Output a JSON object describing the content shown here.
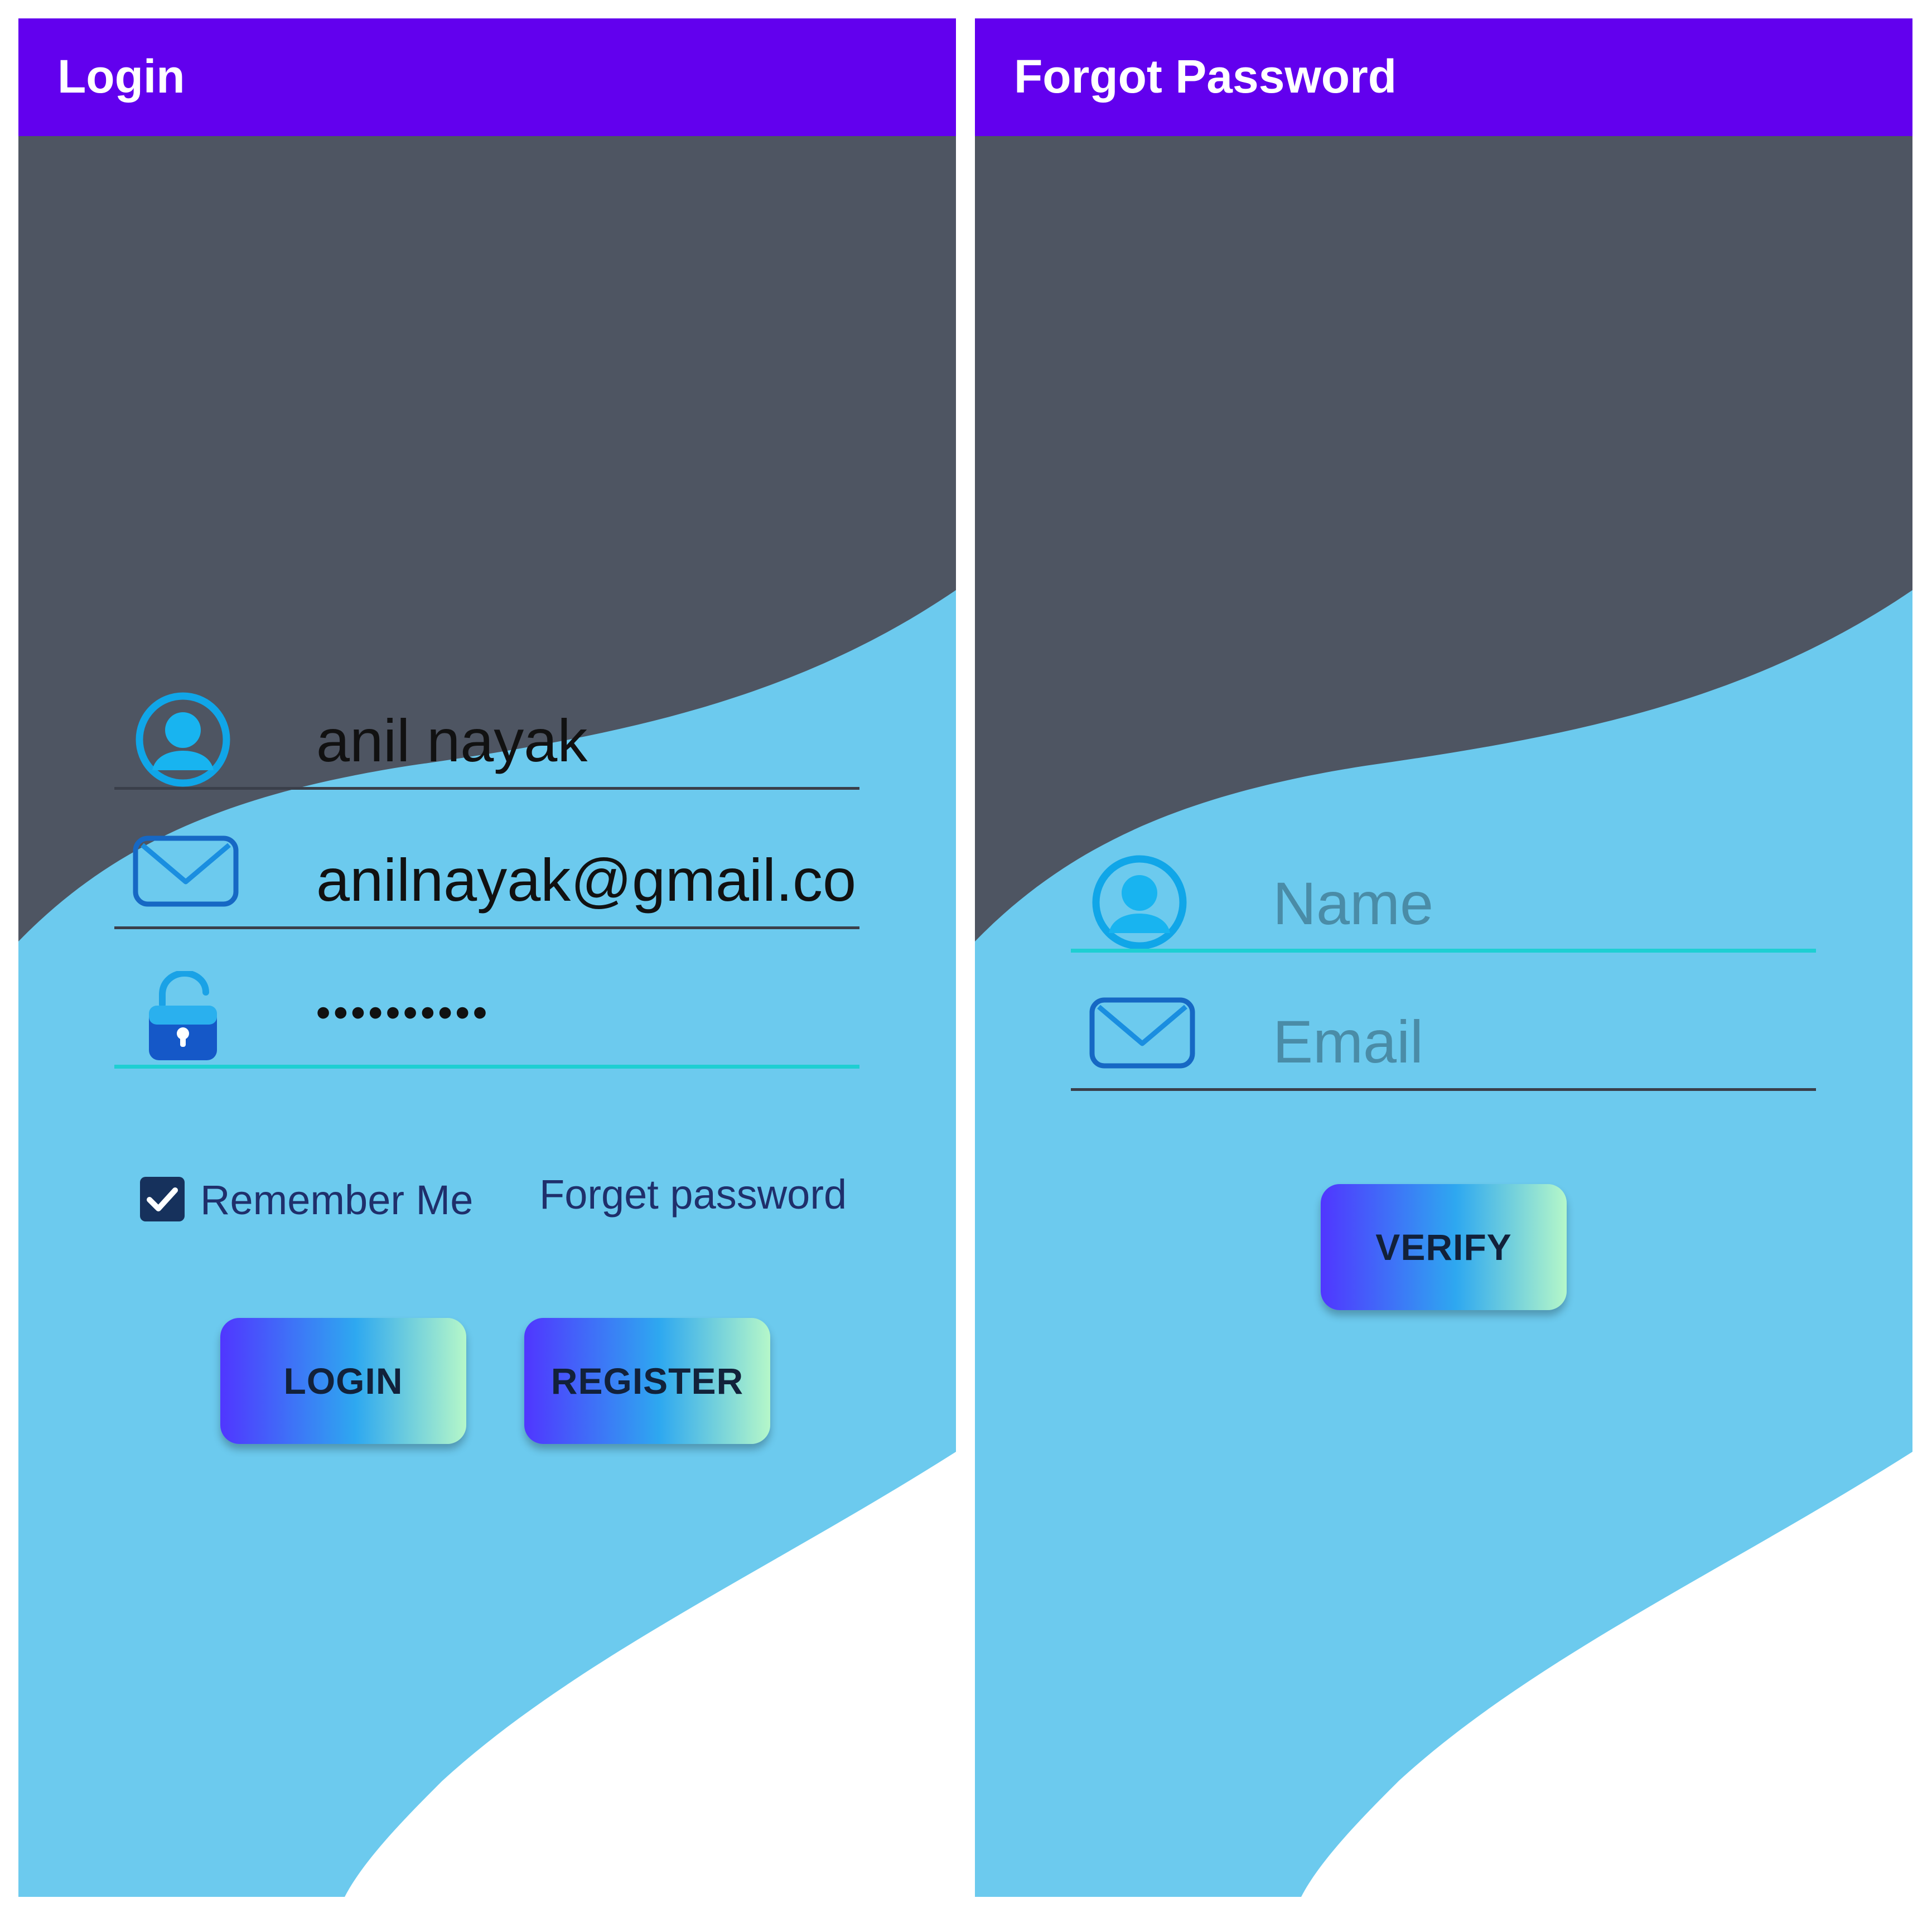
{
  "colors": {
    "app_bar": "#6200ee",
    "dark_wave": "#4e5562",
    "light_wave": "#6ccaee",
    "focus_line": "#1ecfd2",
    "text_dark": "#1f2f6b"
  },
  "login_screen": {
    "title": "Login",
    "name_field": {
      "value": "anil nayak",
      "icon": "user-circle-icon"
    },
    "email_field": {
      "value": "anilnayak@gmail.con",
      "icon": "envelope-icon"
    },
    "password_field": {
      "value": "••••••••••",
      "icon": "unlock-padlock-icon"
    },
    "remember_me": {
      "label": "Remember Me",
      "checked": true,
      "icon": "checkmark-icon"
    },
    "forget_password_link": "Forget password",
    "login_button": "LOGIN",
    "register_button": "REGISTER"
  },
  "forgot_screen": {
    "title": "Forgot Password",
    "name_field": {
      "placeholder": "Name",
      "icon": "user-circle-icon"
    },
    "email_field": {
      "placeholder": "Email",
      "icon": "envelope-icon"
    },
    "verify_button": "VERIFY"
  }
}
